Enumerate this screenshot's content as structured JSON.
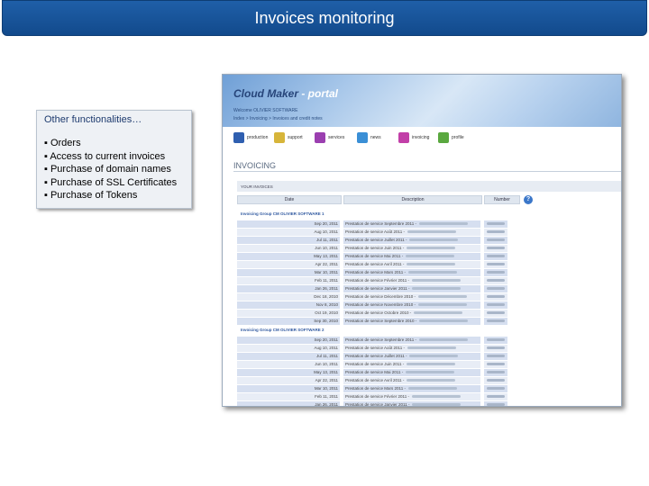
{
  "slide": {
    "title": "Invoices monitoring"
  },
  "functionalities": {
    "heading": "Other functionalities…",
    "items": [
      "▪ Orders",
      "▪ Access to current invoices",
      "▪ Purchase of domain names",
      "▪ Purchase of SSL Certificates",
      "▪ Purchase of Tokens"
    ]
  },
  "portal": {
    "logo_main": "Cloud Maker",
    "logo_sub": " - portal",
    "welcome": "Welcome OLIVIER SOFTWARE",
    "breadcrumb": "Index > Invoicing > Invoices and credit notes",
    "menu": [
      {
        "label": "production",
        "icon": "production-icon",
        "color": "#2f5fb0"
      },
      {
        "label": "support",
        "icon": "support-icon",
        "color": "#d7b53a"
      },
      {
        "label": "services",
        "icon": "services-icon",
        "color": "#9b3fb0"
      },
      {
        "label": "news",
        "icon": "news-icon",
        "color": "#3a8fd6"
      },
      {
        "label": "invoicing",
        "icon": "invoicing-icon",
        "color": "#c23fa8"
      },
      {
        "label": "profile",
        "icon": "profile-icon",
        "color": "#5aa83f"
      }
    ],
    "section_title": "INVOICING",
    "your_invoices": "YOUR INVOICES",
    "columns": {
      "date": "Date",
      "description": "Description",
      "number": "Number"
    },
    "groups": [
      {
        "title": "Invoicing Group CM OLIVIER SOFTWARE 1",
        "rows": [
          {
            "date": "Sep 20, 2011",
            "desc": "Prestation de service Septembre 2011 -"
          },
          {
            "date": "Aug 10, 2011",
            "desc": "Prestation de service Août 2011 -"
          },
          {
            "date": "Jul 11, 2011",
            "desc": "Prestation de service Juillet 2011 -"
          },
          {
            "date": "Jun 10, 2011",
            "desc": "Prestation de service Juin 2011 -"
          },
          {
            "date": "May 13, 2011",
            "desc": "Prestation de service Mai 2011 -"
          },
          {
            "date": "Apr 22, 2011",
            "desc": "Prestation de service Avril 2011 -"
          },
          {
            "date": "Mar 10, 2011",
            "desc": "Prestation de service Mars 2011 -"
          },
          {
            "date": "Feb 11, 2011",
            "desc": "Prestation de service Février 2011 -"
          },
          {
            "date": "Jan 26, 2011",
            "desc": "Prestation de service Janvier 2011 -"
          },
          {
            "date": "Dec 18, 2010",
            "desc": "Prestation de service Décembre 2010 -"
          },
          {
            "date": "Nov 8, 2010",
            "desc": "Prestation de service Novembre 2010 -"
          },
          {
            "date": "Oct 19, 2010",
            "desc": "Prestation de service Octobre 2010 -"
          },
          {
            "date": "Sep 30, 2010",
            "desc": "Prestation de service Septembre 2010 -"
          }
        ]
      },
      {
        "title": "Invoicing Group CM OLIVIER SOFTWARE 2",
        "rows": [
          {
            "date": "Sep 20, 2011",
            "desc": "Prestation de service Septembre 2011 -"
          },
          {
            "date": "Aug 10, 2011",
            "desc": "Prestation de service Août 2011 -"
          },
          {
            "date": "Jul 11, 2011",
            "desc": "Prestation de service Juillet 2011 -"
          },
          {
            "date": "Jun 10, 2011",
            "desc": "Prestation de service Juin 2011 -"
          },
          {
            "date": "May 13, 2011",
            "desc": "Prestation de service Mai 2011 -"
          },
          {
            "date": "Apr 22, 2011",
            "desc": "Prestation de service Avril 2011 -"
          },
          {
            "date": "Mar 10, 2011",
            "desc": "Prestation de service Mars 2011 -"
          },
          {
            "date": "Feb 11, 2011",
            "desc": "Prestation de service Février 2011 -"
          },
          {
            "date": "Jan 26, 2011",
            "desc": "Prestation de service Janvier 2011 -"
          }
        ]
      }
    ]
  }
}
